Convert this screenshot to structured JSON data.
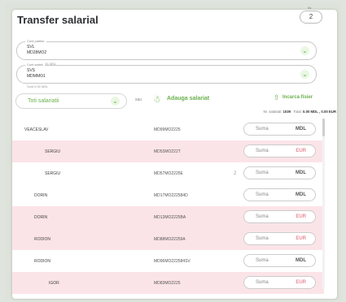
{
  "header": {
    "title": "Transfer salarial",
    "nr_label": "Nr.",
    "nr_value": "2"
  },
  "payer_account": {
    "legend": "Cont platitor",
    "line1": "SVL",
    "line2": "MD28MO2",
    "balance": "Sold 20.007.51 MDL"
  },
  "salary_account": {
    "legend": "Cont salarii",
    "line1": "SVS",
    "line2": "MDMMO1",
    "balance": "Sold 0.00 MDL"
  },
  "toolbar": {
    "filter_label": "Toti salariatii",
    "or_label": "sau",
    "add_label": "Adauga salariat",
    "upload_label": "Incarca fisier"
  },
  "summary": {
    "count_label": "Nr. salariati:",
    "count_value": "1039",
    "total_label": "Total:",
    "total_value": "0.00 MDL , 0.00 EUR"
  },
  "rows": [
    {
      "name": "VEACESLAV",
      "iban": "MD99MO2225",
      "placeholder": "Suma",
      "currency": "MDL",
      "extra": ""
    },
    {
      "name": "SERGIU",
      "iban": "MD53MO222T",
      "placeholder": "Suma",
      "currency": "EUR",
      "extra": ""
    },
    {
      "name": "SERGIU",
      "iban": "MD57MO2225E",
      "placeholder": "Suma",
      "currency": "MDL",
      "extra": "2"
    },
    {
      "name": "DORIN",
      "iban": "MD17MO222584D",
      "placeholder": "Suma",
      "currency": "MDL",
      "extra": ""
    },
    {
      "name": "DORIN",
      "iban": "MD13MO2225BA",
      "placeholder": "Suma",
      "currency": "EUR",
      "extra": ""
    },
    {
      "name": "RODION",
      "iban": "MD88MO22259A",
      "placeholder": "Suma",
      "currency": "EUR",
      "extra": ""
    },
    {
      "name": "RODION",
      "iban": "MD96MO222584SV",
      "placeholder": "Suma",
      "currency": "MDL",
      "extra": ""
    },
    {
      "name": "IGOR",
      "iban": "MD83MO2225",
      "placeholder": "Suma",
      "currency": "EUR",
      "extra": ""
    }
  ]
}
